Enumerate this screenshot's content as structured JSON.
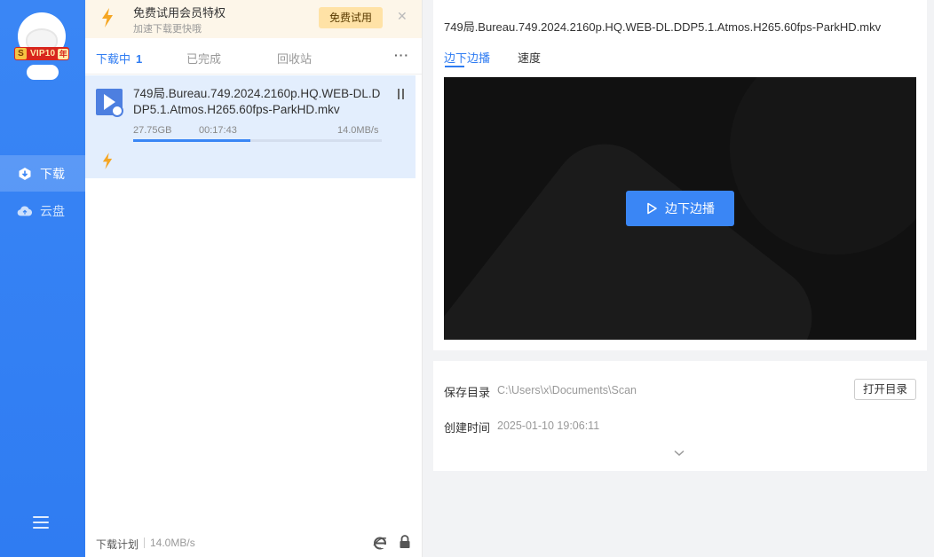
{
  "sidebar": {
    "vip_badge": {
      "s": "S",
      "text": "VIP10",
      "year": "年"
    },
    "items": [
      {
        "label": "下载",
        "icon": "download-icon",
        "active": true
      },
      {
        "label": "云盘",
        "icon": "cloud-icon",
        "active": false
      }
    ],
    "menu_icon": "menu-icon"
  },
  "promo": {
    "title": "免费试用会员特权",
    "subtitle": "加速下载更快哦",
    "button": "免费试用",
    "close": "✕"
  },
  "tabs": [
    {
      "label": "下载中",
      "count": "1",
      "active": true
    },
    {
      "label": "已完成",
      "active": false
    },
    {
      "label": "回收站",
      "active": false
    }
  ],
  "more": "···",
  "task": {
    "name": "749局.Bureau.749.2024.2160p.HQ.WEB-DL.DDP5.1.Atmos.H265.60fps-ParkHD.mkv",
    "size": "27.75GB",
    "time": "00:17:43",
    "speed": "14.0MB/s",
    "progress": 0.47
  },
  "footer": {
    "plan": "下载计划",
    "speed": "14.0MB/s"
  },
  "detail": {
    "title": "749局.Bureau.749.2024.2160p.HQ.WEB-DL.DDP5.1.Atmos.H265.60fps-ParkHD.mkv",
    "tabs": [
      "边下边播",
      "速度"
    ],
    "play_button": "边下边播",
    "save_dir_label": "保存目录",
    "save_dir": "C:\\Users\\x\\Documents\\Scan",
    "open_dir_button": "打开目录",
    "created_label": "创建时间",
    "created": "2025-01-10 19:06:11"
  },
  "colors": {
    "accent": "#2f7cf2",
    "rail": "#3a86f5",
    "promo_bg": "#fdf6e9",
    "task_bg": "#e3eefd",
    "bolt": "#f5a623"
  }
}
